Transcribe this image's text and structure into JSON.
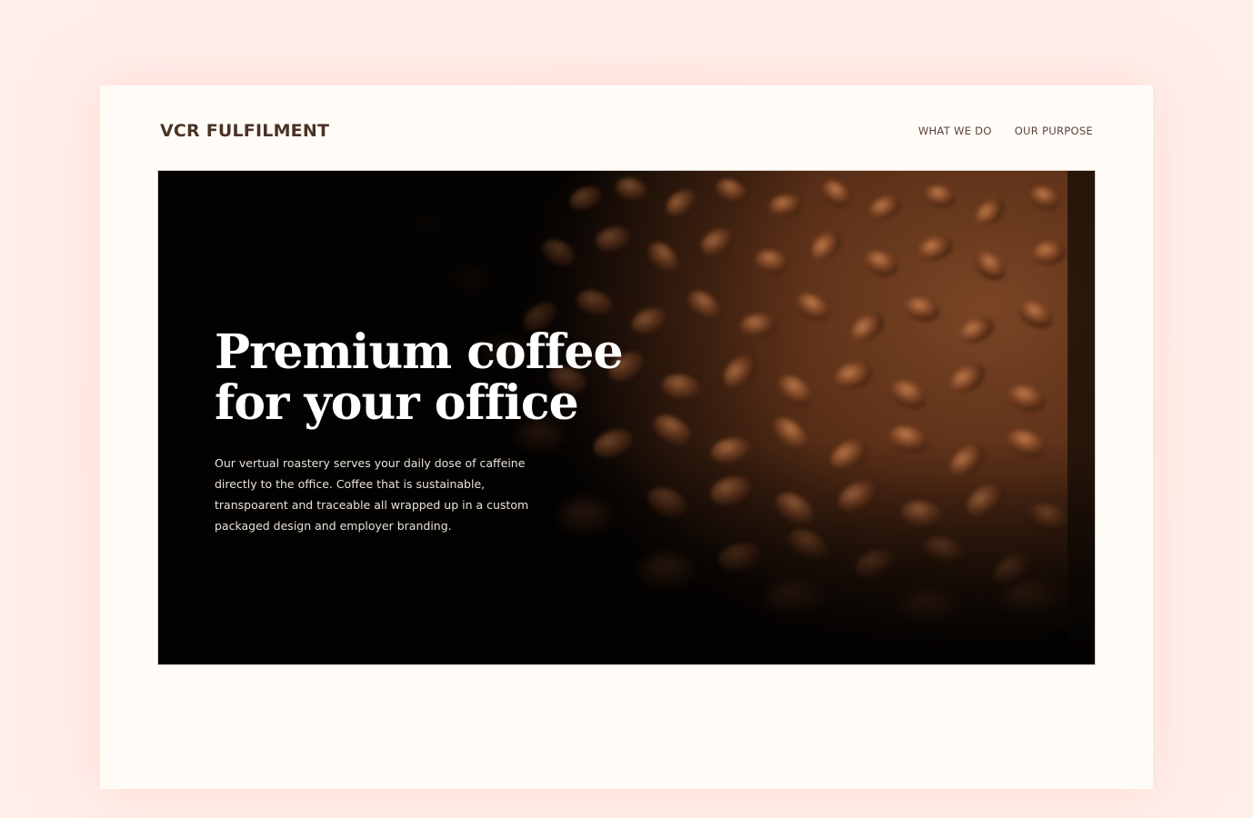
{
  "site": {
    "logo": "VCR FULFILMENT"
  },
  "nav": {
    "items": [
      {
        "label": "WHAT WE DO"
      },
      {
        "label": "OUR PURPOSE"
      }
    ]
  },
  "hero": {
    "title": "Premium coffee\nfor your office",
    "body": "Our vertual roastery serves your daily dose of caffeine directly to the office. Coffee that is sustainable, transpoarent and traceable all wrapped up in a custom packaged design and employer branding.",
    "image": "coffee-beans-photo"
  },
  "colors": {
    "page_background": "#ffeeea",
    "card_background": "#fffcf8",
    "brand_text": "#4a3326",
    "hero_background": "#050302"
  }
}
